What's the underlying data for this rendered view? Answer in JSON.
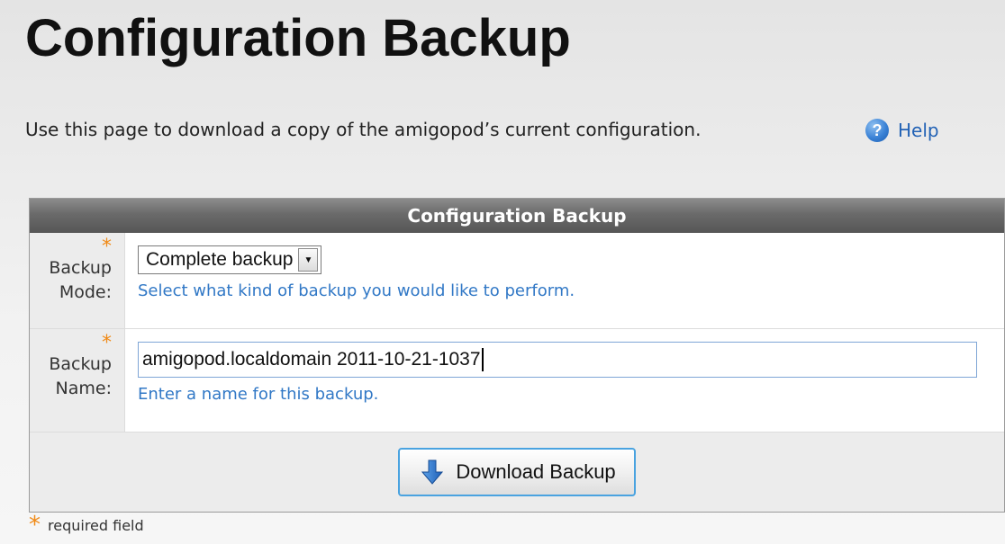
{
  "page": {
    "title": "Configuration Backup",
    "intro": "Use this page to download a copy of the amigopod’s current configuration.",
    "help_label": "Help",
    "help_icon": "help-circle-icon"
  },
  "panel": {
    "header": "Configuration Backup",
    "required_marker": "*",
    "backup_mode": {
      "label_line1": "Backup",
      "label_line2": "Mode:",
      "selected": "Complete backup",
      "hint": "Select what kind of backup you would like to perform."
    },
    "backup_name": {
      "label_line1": "Backup",
      "label_line2": "Name:",
      "value": "amigopod.localdomain 2011-10-21-1037",
      "hint": "Enter a name for this backup."
    },
    "download_button": {
      "label": "Download Backup",
      "icon": "download-arrow-icon"
    }
  },
  "footnote": {
    "marker": "*",
    "text": "required field"
  },
  "colors": {
    "required": "#f08a17",
    "hint": "#3178c6",
    "header": "#6a6a6a",
    "button_border": "#4aa3e0"
  }
}
